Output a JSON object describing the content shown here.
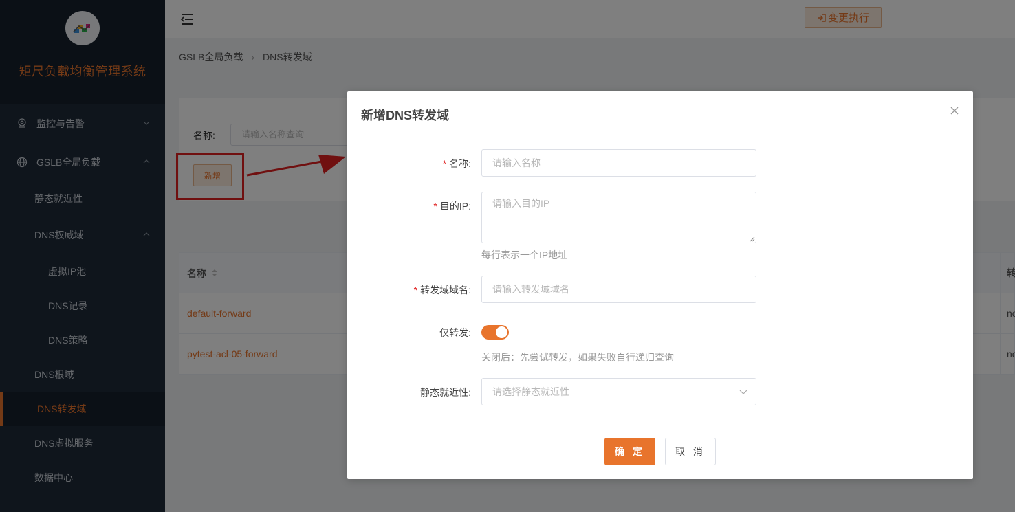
{
  "sidebar": {
    "system_title": "矩尺负载均衡管理系统",
    "items": [
      {
        "label": "监控与告警"
      },
      {
        "label": "GSLB全局负载"
      }
    ],
    "subitems": {
      "static_proximity": "静态就近性",
      "dns_authority": "DNS权威域",
      "virtual_ip_pool": "虚拟IP池",
      "dns_record": "DNS记录",
      "dns_policy": "DNS策略",
      "dns_root": "DNS根域",
      "dns_forward": "DNS转发域",
      "dns_virtual_service": "DNS虚拟服务",
      "data_center": "数据中心"
    }
  },
  "header": {
    "exec_button": "变更执行"
  },
  "breadcrumb": [
    "GSLB全局负载",
    "DNS转发域"
  ],
  "filter": {
    "name_label": "名称:",
    "name_placeholder": "请输入名称查询",
    "add_button": "新增"
  },
  "table": {
    "col_name": "名称",
    "col_right": "转",
    "rows": [
      {
        "name": "default-forward",
        "right": "no"
      },
      {
        "name": "pytest-acl-05-forward",
        "right": "no"
      }
    ]
  },
  "dialog": {
    "title": "新增DNS转发域",
    "name_label": "名称:",
    "name_placeholder": "请输入名称",
    "ip_label": "目的IP:",
    "ip_placeholder": "请输入目的IP",
    "ip_hint": "每行表示一个IP地址",
    "domain_label": "转发域域名:",
    "domain_placeholder": "请输入转发域域名",
    "forward_only_label": "仅转发:",
    "forward_only_on": true,
    "forward_only_hint": "关闭后：先尝试转发，如果失败自行递归查询",
    "proximity_label": "静态就近性:",
    "proximity_placeholder": "请选择静态就近性",
    "ok_button": "确 定",
    "cancel_button": "取 消"
  },
  "colors": {
    "accent": "#e8742c",
    "sidebar_bg": "#1f2a38",
    "annotation_red": "#e02020"
  }
}
